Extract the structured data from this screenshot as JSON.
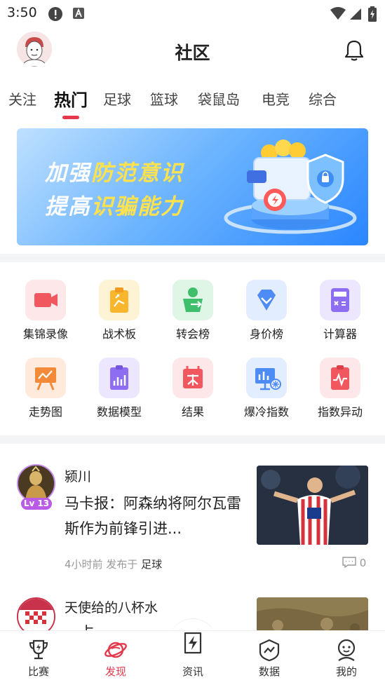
{
  "status_bar": {
    "time": "3:50"
  },
  "header": {
    "title": "社区"
  },
  "tabs": [
    {
      "label": "关注"
    },
    {
      "label": "热门"
    },
    {
      "label": "足球"
    },
    {
      "label": "篮球"
    },
    {
      "label": "袋鼠岛"
    },
    {
      "label": "电竞"
    },
    {
      "label": "综合"
    }
  ],
  "active_tab": "热门",
  "banner": {
    "line1_a": "加强",
    "line1_b": "防范意识",
    "line2_a": "提高",
    "line2_b": "识骗能力"
  },
  "tools": [
    {
      "label": "集锦录像",
      "icon": "video-camera-icon",
      "color": "#f0575f"
    },
    {
      "label": "战术板",
      "icon": "tactics-clipboard-icon",
      "color": "#f7b62d"
    },
    {
      "label": "转会榜",
      "icon": "transfer-person-icon",
      "color": "#3fbf6b"
    },
    {
      "label": "身价榜",
      "icon": "diamond-value-icon",
      "color": "#4d8cf5"
    },
    {
      "label": "计算器",
      "icon": "calculator-icon",
      "color": "#8d6ef2"
    },
    {
      "label": "走势图",
      "icon": "trend-board-icon",
      "color": "#f28a3a"
    },
    {
      "label": "数据模型",
      "icon": "data-model-icon",
      "color": "#8d6ef2"
    },
    {
      "label": "结果",
      "icon": "result-calendar-icon",
      "color": "#f0575f"
    },
    {
      "label": "爆冷指数",
      "icon": "upset-index-icon",
      "color": "#4d8cf5"
    },
    {
      "label": "指数异动",
      "icon": "index-change-icon",
      "color": "#f0575f"
    }
  ],
  "posts": [
    {
      "author": "颍川",
      "level": "Lv 13",
      "title": "马卡报：阿森纳将阿尔瓦雷斯作为前锋引进...",
      "time": "4小时前",
      "published_in": "发布于",
      "category": "足球",
      "comments": "0"
    },
    {
      "author": "天使给的八杯水",
      "title": "…占"
    }
  ],
  "bottom_nav": [
    {
      "label": "比赛",
      "icon": "trophy-icon"
    },
    {
      "label": "发现",
      "icon": "planet-icon"
    },
    {
      "label": "资讯",
      "icon": "news-bolt-icon"
    },
    {
      "label": "数据",
      "icon": "data-shield-icon"
    },
    {
      "label": "我的",
      "icon": "profile-icon"
    }
  ],
  "active_nav": "发现",
  "colors": {
    "accent": "#e5384c",
    "level_badge": "#b95be6"
  }
}
